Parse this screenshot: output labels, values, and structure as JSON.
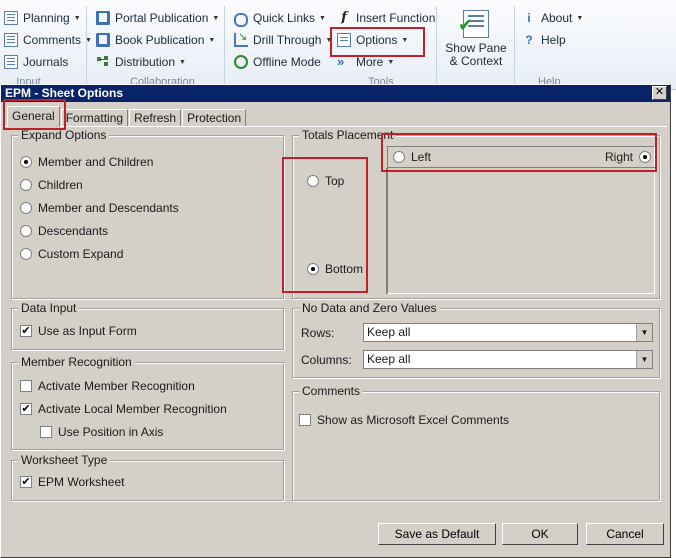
{
  "ribbon": {
    "col1": [
      "Planning",
      "Comments",
      "Journals"
    ],
    "col1_group": "... Input",
    "col2": [
      "Portal Publication",
      "Book Publication",
      "Distribution"
    ],
    "col2_group": "Collaboration",
    "col3": [
      "Quick Links",
      "Drill Through",
      "Offline Mode"
    ],
    "col4": [
      "Insert Function",
      "Options",
      "More"
    ],
    "col34_group": "Tools",
    "show_pane_line1": "Show Pane",
    "show_pane_line2": "& Context",
    "col5": [
      "About",
      "Help"
    ],
    "col5_group": "Help"
  },
  "dialog": {
    "title": "EPM - Sheet Options",
    "close": "✕",
    "tabs": [
      "General",
      "Formatting",
      "Refresh",
      "Protection"
    ],
    "expand_options": {
      "title": "Expand Options",
      "options": [
        "Member and Children",
        "Children",
        "Member and Descendants",
        "Descendants",
        "Custom Expand"
      ],
      "selected": "Member and Children"
    },
    "totals_placement": {
      "title": "Totals Placement",
      "left": "Left",
      "right": "Right",
      "top": "Top",
      "bottom": "Bottom",
      "selected_horizontal": "Right",
      "selected_vertical": "Bottom"
    },
    "data_input": {
      "title": "Data Input",
      "use_as_input_form": "Use as Input Form",
      "use_as_input_form_checked": true
    },
    "member_recognition": {
      "title": "Member Recognition",
      "activate": "Activate Member Recognition",
      "activate_checked": false,
      "activate_local": "Activate Local Member Recognition",
      "activate_local_checked": true,
      "use_position": "Use Position in Axis",
      "use_position_checked": false
    },
    "worksheet_type": {
      "title": "Worksheet Type",
      "epm_worksheet": "EPM Worksheet",
      "epm_worksheet_checked": true
    },
    "no_data": {
      "title": "No Data and Zero Values",
      "rows_label": "Rows:",
      "rows_value": "Keep all",
      "columns_label": "Columns:",
      "columns_value": "Keep all"
    },
    "comments": {
      "title": "Comments",
      "show_excel": "Show as Microsoft Excel Comments",
      "show_excel_checked": false
    },
    "buttons": {
      "save_default": "Save as Default",
      "ok": "OK",
      "cancel": "Cancel"
    }
  },
  "check_mark": "✔",
  "dropdown_glyph": "▼",
  "colors": {
    "titlebar": "#0a246a",
    "dialog_bg": "#d4d0c8",
    "highlight": "#c0202a",
    "ribbon_bg": "#e7edf6"
  }
}
